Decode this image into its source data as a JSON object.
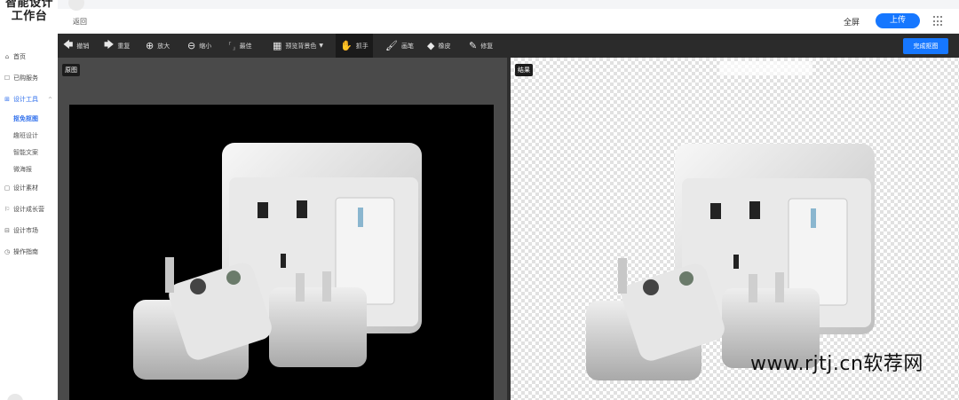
{
  "sidebar": {
    "logo_line1": "智能设计",
    "logo_line2": "工作台",
    "items": [
      {
        "label": "首页",
        "icon": "home-icon"
      },
      {
        "label": "已购服务",
        "icon": "bag-icon"
      },
      {
        "label": "设计工具",
        "icon": "apps-icon",
        "expanded": true
      },
      {
        "label": "设计素材",
        "icon": "material-icon"
      },
      {
        "label": "设计成长营",
        "icon": "flag-icon"
      },
      {
        "label": "设计市场",
        "icon": "market-icon"
      },
      {
        "label": "操作指南",
        "icon": "help-icon"
      }
    ],
    "sub_items": [
      {
        "label": "抠免抠图",
        "current": true
      },
      {
        "label": "趣班设计"
      },
      {
        "label": "智能文案"
      },
      {
        "label": "微海报"
      }
    ]
  },
  "header": {
    "back_label": "返回",
    "fullscreen_label": "全屏",
    "upload_label": "上传"
  },
  "toolbar": {
    "tools": [
      {
        "label": "撤销",
        "icon": "undo-icon"
      },
      {
        "label": "重复",
        "icon": "redo-icon"
      },
      {
        "label": "放大",
        "icon": "zoom-in-icon"
      },
      {
        "label": "缩小",
        "icon": "zoom-out-icon"
      },
      {
        "label": "最佳",
        "icon": "fit-icon"
      },
      {
        "label": "预览背景色",
        "icon": "checker-icon"
      },
      {
        "label": "抓手",
        "icon": "hand-icon",
        "active": true
      },
      {
        "label": "画笔",
        "icon": "brush-icon"
      },
      {
        "label": "橡皮",
        "icon": "eraser-icon"
      },
      {
        "label": "修复",
        "icon": "repair-icon"
      }
    ],
    "done_label": "完成抠图"
  },
  "panels": {
    "original_label": "原图",
    "result_label": "结果"
  },
  "watermark": "www.rjtj.cn软荐网",
  "colors": {
    "accent": "#1677ff",
    "toolbar_bg": "#2b2b2b",
    "panel_bg": "#4a4a4a",
    "active_nav": "#2f6fec"
  }
}
